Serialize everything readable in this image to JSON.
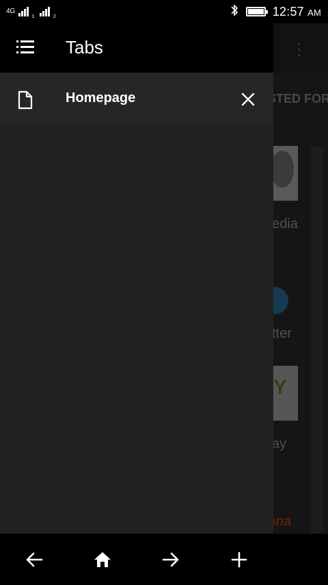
{
  "status_bar": {
    "network_type": "4G",
    "signal_1_sub": "1",
    "signal_2_sub": "2",
    "time": "12:57",
    "ampm": "AM",
    "icons": [
      "signal-icon",
      "bluetooth-icon",
      "battery-icon"
    ]
  },
  "background_page": {
    "section_fragment": "STED FOR",
    "sites": [
      "edia",
      "tter",
      "ay",
      "ana"
    ],
    "ebay_fragment": "Y",
    "hana_fragment": "ana"
  },
  "drawer": {
    "title": "Tabs",
    "menu_icon": "list-icon",
    "tabs": [
      {
        "title": "Homepage",
        "icon": "page-icon",
        "close_icon": "close-icon"
      }
    ]
  },
  "bottom_nav": {
    "buttons": [
      "back-arrow-icon",
      "home-icon",
      "forward-arrow-icon",
      "plus-icon"
    ]
  },
  "colors": {
    "drawer_bg": "#212121",
    "header_bg": "#000000",
    "text": "#ffffff"
  }
}
